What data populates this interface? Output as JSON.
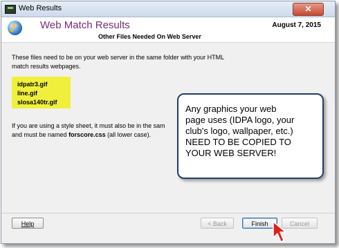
{
  "window": {
    "title": "Web Results",
    "close_label": "✕"
  },
  "header": {
    "title": "Web Match Results",
    "subtitle": "Other Files Needed On Web Server",
    "date": "August  7, 2015"
  },
  "content": {
    "paragraph1": "These files need to be on your web server in the same folder with your HTML match results webpages.",
    "files": [
      "idpatr3.gif",
      "line.gif",
      "slosa140tr.gif"
    ],
    "paragraph2_prefix": "If you are using a style sheet, it must also be in the sam",
    "paragraph2_line2": "and must be named ",
    "paragraph2_filename": "forscore.css",
    "paragraph2_suffix": " (all lower case)."
  },
  "callout": {
    "line1": "Any graphics your web",
    "line2": "page uses (IDPA logo, your",
    "line3": "club's logo, wallpaper, etc.)",
    "line4": "NEED TO BE COPIED TO",
    "line5": "YOUR WEB SERVER!"
  },
  "buttons": {
    "help": "Help",
    "back": "< Back",
    "finish": "Finish",
    "cancel": "Cancel"
  },
  "colors": {
    "title_accent": "#7a2b73",
    "highlight": "#f0f03c",
    "callout_border": "#1f3f66",
    "cursor": "#e0201a"
  }
}
